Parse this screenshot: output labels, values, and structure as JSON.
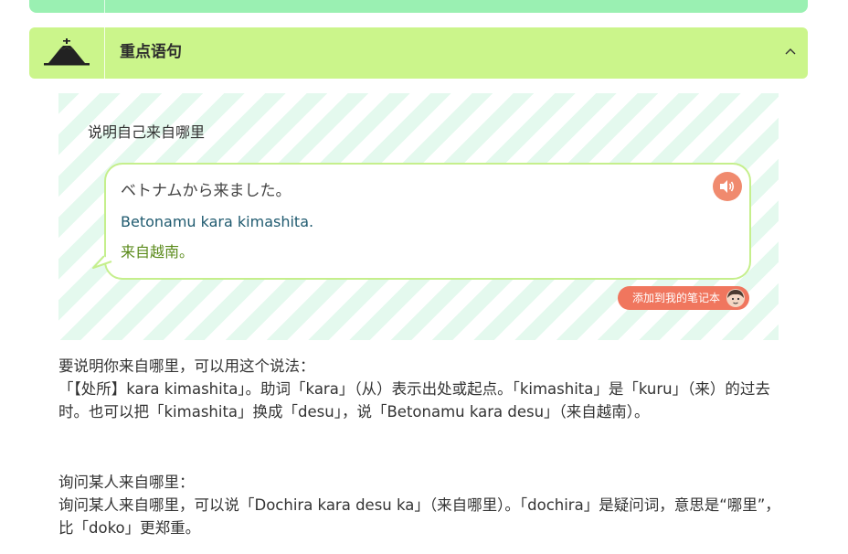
{
  "section": {
    "title": "重点语句"
  },
  "example": {
    "caption": "说明自己来自哪里",
    "japanese": "ベトナムから来ました。",
    "romaji": "Betonamu kara kimashita.",
    "chinese": "来自越南。",
    "note_button": "添加到我的笔记本"
  },
  "explanation": {
    "heading1": "要说明你来自哪里，可以用这个说法：",
    "body1": "「【处所】kara kimashita」。助词「kara」（从）表示出处或起点。「kimashita」是「kuru」（来）的过去时。也可以把「kimashita」换成「desu」，说「Betonamu kara desu」（来自越南）。",
    "heading2": "询问某人来自哪里：",
    "body2": "询问某人来自哪里，可以说「Dochira kara desu ka」（来自哪里）。「dochira」是疑问词，意思是“哪里”，比「doko」更郑重。"
  },
  "colors": {
    "top_bar": "#9af0b2",
    "header": "#cbf58b",
    "accent": "#f0765e",
    "stripe": "#e4f9ee"
  }
}
